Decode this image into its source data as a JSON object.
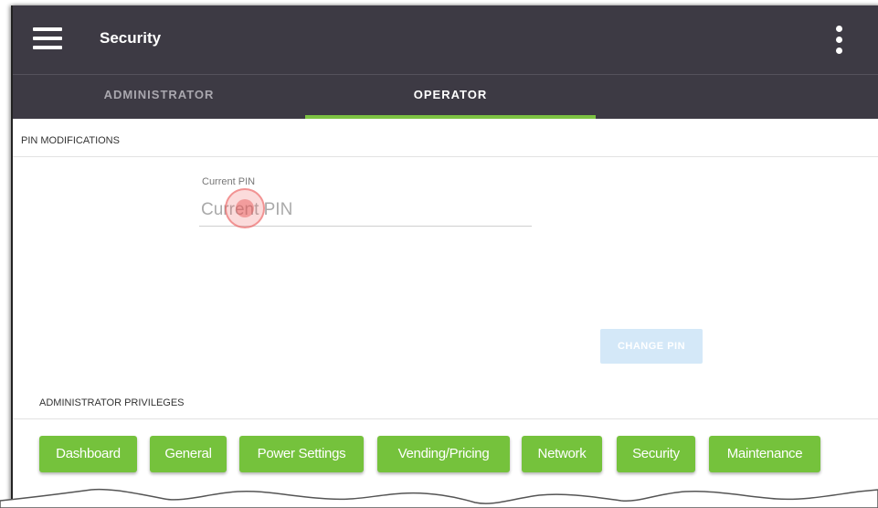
{
  "appbar": {
    "title": "Security",
    "menu_icon": "hamburger-menu-icon",
    "overflow_icon": "more-vert-icon"
  },
  "tabs": [
    {
      "label": "ADMINISTRATOR",
      "active": false
    },
    {
      "label": "OPERATOR",
      "active": true
    }
  ],
  "pin_section": {
    "header": "PIN MODIFICATIONS",
    "field_label": "Current PIN",
    "placeholder": "Current PIN",
    "value": "",
    "button_label": "CHANGE PIN"
  },
  "privileges": {
    "header": "ADMINISTRATOR PRIVILEGES",
    "items": [
      "Dashboard",
      "General",
      "Power Settings",
      "Vending/Pricing",
      "Network",
      "Security",
      "Maintenance"
    ]
  },
  "colors": {
    "appbar": "#3d3a44",
    "accent": "#7cc242",
    "chip": "#75c23c",
    "button_disabled": "#d4e8f8"
  }
}
